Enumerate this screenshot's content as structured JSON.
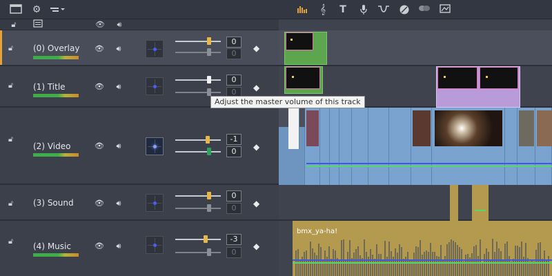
{
  "toolbar": {
    "icons": [
      "layout-icon",
      "settings-icon",
      "track-options-icon",
      "audio-levels-icon",
      "music-icon",
      "title-text-icon",
      "microphone-icon",
      "transition-icon",
      "color-icon",
      "link-icon",
      "image-icon"
    ]
  },
  "tracks": [
    {
      "name": "(0) Overlay",
      "value1": "0",
      "value2": "0",
      "selected": true
    },
    {
      "name": "(1) Title",
      "value1": "0",
      "value2": "0",
      "selected": false
    },
    {
      "name": "(2) Video",
      "value1": "-1",
      "value2": "0",
      "selected": false
    },
    {
      "name": "(3) Sound",
      "value1": "0",
      "value2": "0",
      "selected": false
    },
    {
      "name": "(4) Music",
      "value1": "-3",
      "value2": "0",
      "selected": false
    }
  ],
  "tooltip": "Adjust the master volume of this track",
  "music_clip_label": "bmx_ya-ha!",
  "colors": {
    "accent": "#e8a23a",
    "video_clip": "#7aa4cf",
    "title_clip": "#b89bd8",
    "music_clip": "#b39a4e",
    "keyframe_line": "#53d86a"
  }
}
